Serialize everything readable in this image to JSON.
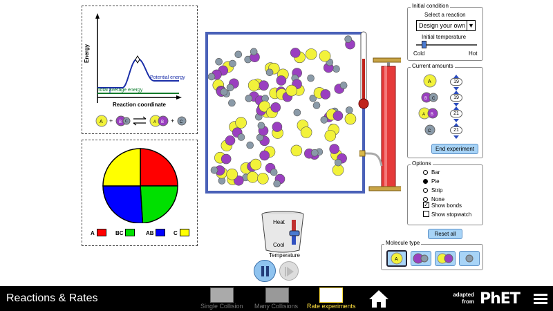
{
  "energy_graph": {
    "ylabel": "Energy",
    "xlabel": "Reaction coordinate",
    "potential_label": "Potential energy",
    "total_label": "Total average energy",
    "reaction": {
      "left": [
        "A",
        "+",
        "BC"
      ],
      "right": [
        "AB",
        "+",
        "C"
      ]
    }
  },
  "pie_legend": [
    {
      "label": "A",
      "color": "#ff0000"
    },
    {
      "label": "BC",
      "color": "#00e000"
    },
    {
      "label": "AB",
      "color": "#0000ff"
    },
    {
      "label": "C",
      "color": "#ffff00"
    }
  ],
  "pie_fractions": {
    "A": 0.25,
    "BC": 0.24,
    "AB": 0.26,
    "C": 0.25
  },
  "thermometer_level": 0.6,
  "heater": {
    "heat_label": "Heat",
    "cool_label": "Cool",
    "temp_label": "Temperature"
  },
  "initial_condition": {
    "title": "Initial condition",
    "select_label": "Select a reaction",
    "selected": "Design your own",
    "temp_label": "Initial temperature",
    "cold": "Cold",
    "hot": "Hot",
    "temp_fraction": 0.1
  },
  "current_amounts": {
    "title": "Current amounts",
    "counts": [
      "19",
      "19",
      "21",
      "21"
    ],
    "end_button": "End experiment"
  },
  "options": {
    "title": "Options",
    "items": [
      "Bar",
      "Pie",
      "Strip",
      "None"
    ],
    "selected": "Pie",
    "show_bonds": "Show bonds",
    "show_stopwatch": "Show stopwatch",
    "bonds_checked": true,
    "stopwatch_checked": false
  },
  "reset_all": "Reset all",
  "molecule_type": {
    "title": "Molecule type"
  },
  "navbar": {
    "title": "Reactions & Rates",
    "tabs": [
      "Single Collision",
      "Many Collisions",
      "Rate experiments"
    ],
    "active_tab": "Rate experiments",
    "adapted": "adapted",
    "from": "from",
    "logo": "PhET"
  },
  "colors": {
    "A": "#f2f23a",
    "B": "#9a3fc0",
    "C": "#8a9aa8",
    "box_border": "#4a61b8",
    "active_tab": "#ffe040"
  }
}
